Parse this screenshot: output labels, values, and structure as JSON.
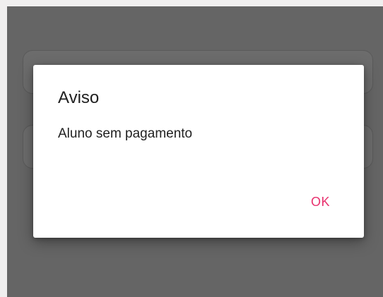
{
  "dialog": {
    "title": "Aviso",
    "message": "Aluno sem pagamento",
    "ok_label": "OK"
  },
  "colors": {
    "scrim": "#656565",
    "accent": "#e8316e",
    "dialog_bg": "#ffffff"
  }
}
